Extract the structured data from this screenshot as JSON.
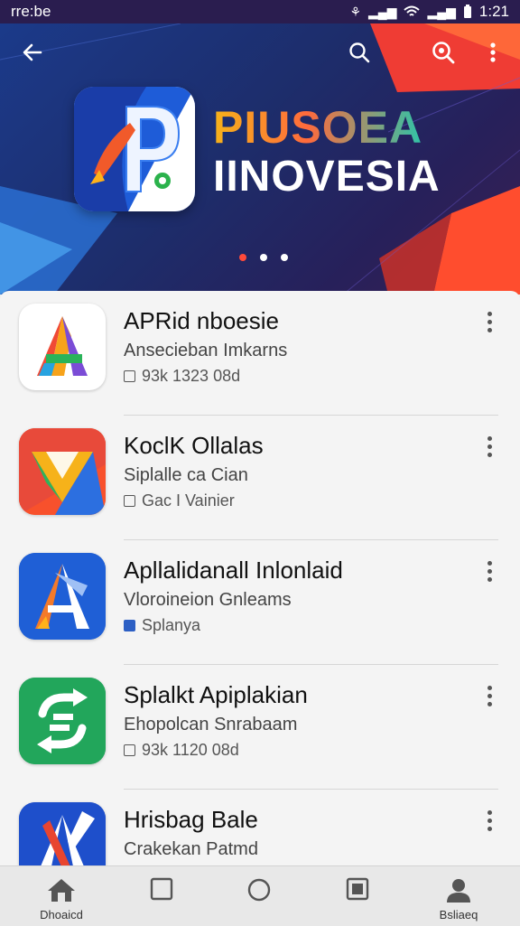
{
  "status_bar": {
    "left_text": "rre:be",
    "time": "1:21"
  },
  "hero": {
    "title_line1": "PIUSOEA",
    "title_line2": "IINOVESIA",
    "page_indicator": {
      "count": 3,
      "active": 1
    }
  },
  "apps": [
    {
      "title": "APRid nboesie",
      "subtitle": "Ansecieban Imkarns",
      "meta": "93k 1323 08d",
      "icon": "letter-a-rainbow-icon"
    },
    {
      "title": "KoclK Ollalas",
      "subtitle": "Siplalle ca Cian",
      "meta": "Gac I Vainier",
      "icon": "colorful-triangle-icon"
    },
    {
      "title": "Apllalidanall Inlonlaid",
      "subtitle": "Vloroineion Gnleams",
      "meta": "Splanya",
      "icon": "rocket-a-icon"
    },
    {
      "title": "Splalkt Apiplakian",
      "subtitle": "Ehopolcan Snrabaam",
      "meta": "93k 1120 08d",
      "icon": "green-refresh-icon"
    },
    {
      "title": "Hrisbag Bale",
      "subtitle": "Crakekan Patmd",
      "meta": "",
      "icon": "blue-pen-a-icon"
    }
  ],
  "bottom_nav": [
    {
      "label": "Dhoaicd",
      "icon": "home-icon"
    },
    {
      "label": "",
      "icon": "square-icon"
    },
    {
      "label": "",
      "icon": "circle-icon"
    },
    {
      "label": "",
      "icon": "stop-icon"
    },
    {
      "label": "Bsliaeq",
      "icon": "profile-icon"
    }
  ]
}
